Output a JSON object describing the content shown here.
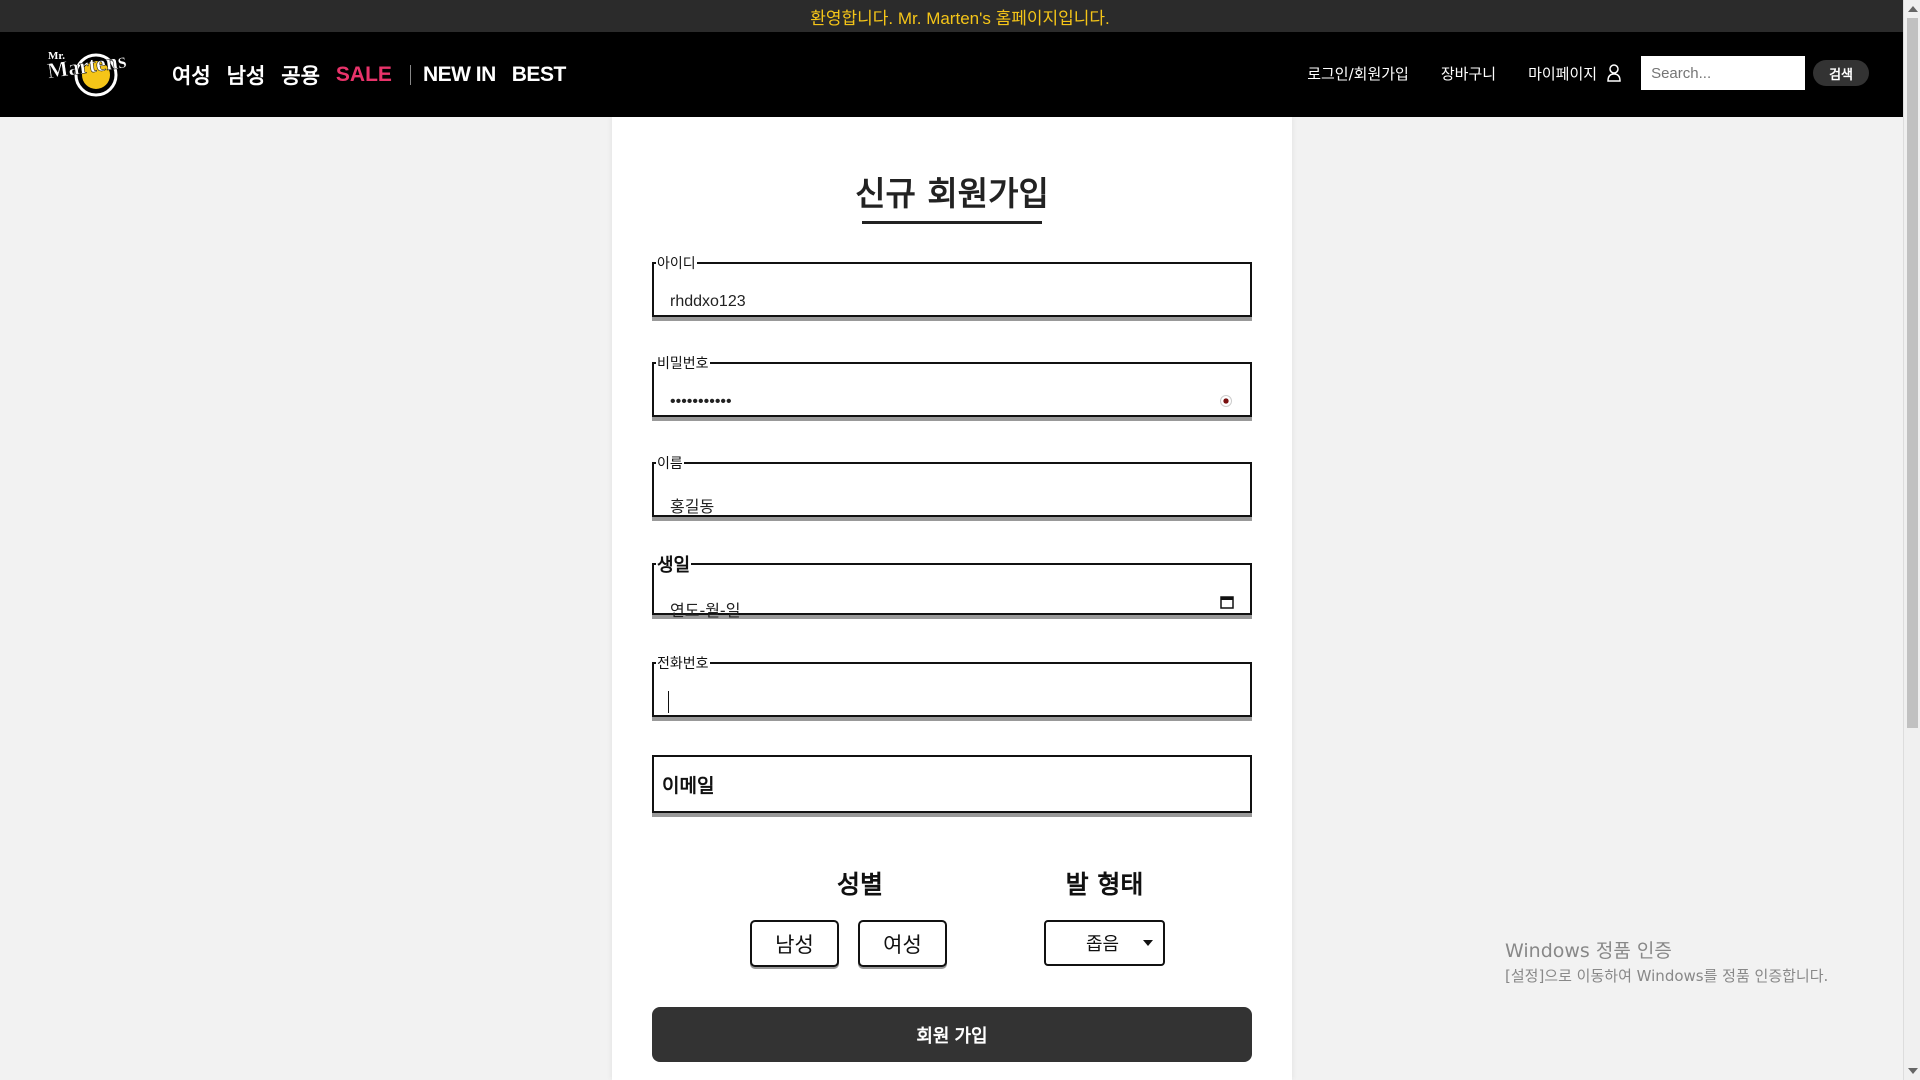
{
  "announcement": "환영합니다. Mr. Marten's 홈페이지입니다.",
  "logo": {
    "text": "Mr. Martens"
  },
  "nav": {
    "items": [
      "여성",
      "남성",
      "공용"
    ],
    "sale": "SALE",
    "new_in": "NEW IN",
    "best": "BEST"
  },
  "header_right": {
    "login": "로그인/회원가입",
    "cart": "장바구니",
    "mypage": "마이페이지",
    "search_placeholder": "Search...",
    "search_button": "검색"
  },
  "form": {
    "title": "신규 회원가입",
    "id": {
      "label": "아이디",
      "value": "rhddxo123"
    },
    "password": {
      "label": "비밀번호",
      "value": "•••••••••••"
    },
    "name": {
      "label": "이름",
      "value": "홍길동"
    },
    "birth": {
      "label": "생일",
      "value": "연도-월-일"
    },
    "phone": {
      "label": "전화번호",
      "value": ""
    },
    "email": {
      "label": "이메일"
    },
    "gender": {
      "label": "성별",
      "options": [
        "남성",
        "여성"
      ]
    },
    "foot": {
      "label": "발 형태",
      "selected": "좁음"
    },
    "submit": "회원 가입"
  },
  "watermark": {
    "line1": "Windows 정품 인증",
    "line2": "[설정]으로 이동하여 Windows를 정품 인증합니다."
  }
}
